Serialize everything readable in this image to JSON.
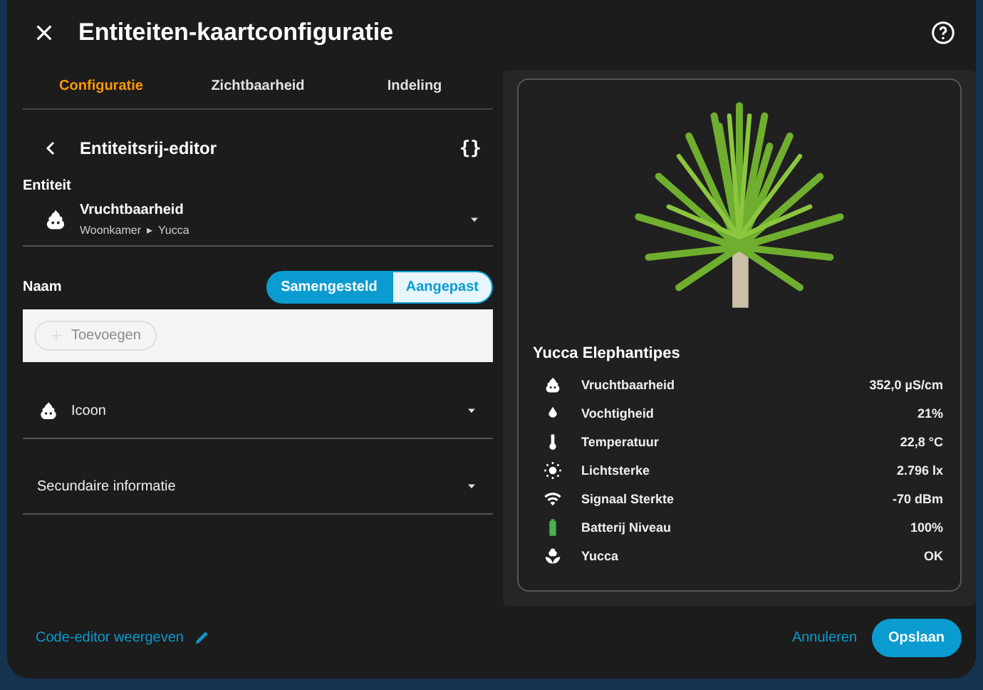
{
  "dialog": {
    "title": "Entiteiten-kaartconfiguratie"
  },
  "tabs": [
    {
      "label": "Configuratie",
      "selected": true
    },
    {
      "label": "Zichtbaarheid",
      "selected": false
    },
    {
      "label": "Indeling",
      "selected": false
    }
  ],
  "editor": {
    "title": "Entiteitsrij-editor",
    "code_toggle": "{}",
    "entity_label": "Entiteit",
    "entity": {
      "name": "Vruchtbaarheid",
      "area": "Woonkamer",
      "separator": "▸",
      "device": "Yucca"
    },
    "name_label": "Naam",
    "name_modes": [
      {
        "label": "Samengesteld",
        "selected": true
      },
      {
        "label": "Aangepast",
        "selected": false
      }
    ],
    "add_button": "Toevoegen",
    "icon_field": "Icoon",
    "secondary_field": "Secundaire informatie"
  },
  "code_editor_link": "Code-editor weergeven",
  "preview": {
    "title": "Yucca Elephantipes",
    "rows": [
      {
        "kind": "fertility",
        "name": "Vruchtbaarheid",
        "value": "352,0 µS/cm"
      },
      {
        "kind": "drop",
        "name": "Vochtigheid",
        "value": "21%"
      },
      {
        "kind": "thermometer",
        "name": "Temperatuur",
        "value": "22,8 °C"
      },
      {
        "kind": "sun",
        "name": "Lichtsterke",
        "value": "2.796 lx"
      },
      {
        "kind": "wifi",
        "name": "Signaal Sterkte",
        "value": "-70 dBm"
      },
      {
        "kind": "battery",
        "name": "Batterij Niveau",
        "value": "100%"
      },
      {
        "kind": "flower",
        "name": "Yucca",
        "value": "OK"
      }
    ]
  },
  "buttons": [
    {
      "label": "Annuleren",
      "kind": "text"
    },
    {
      "label": "Opslaan",
      "kind": "filled"
    }
  ]
}
